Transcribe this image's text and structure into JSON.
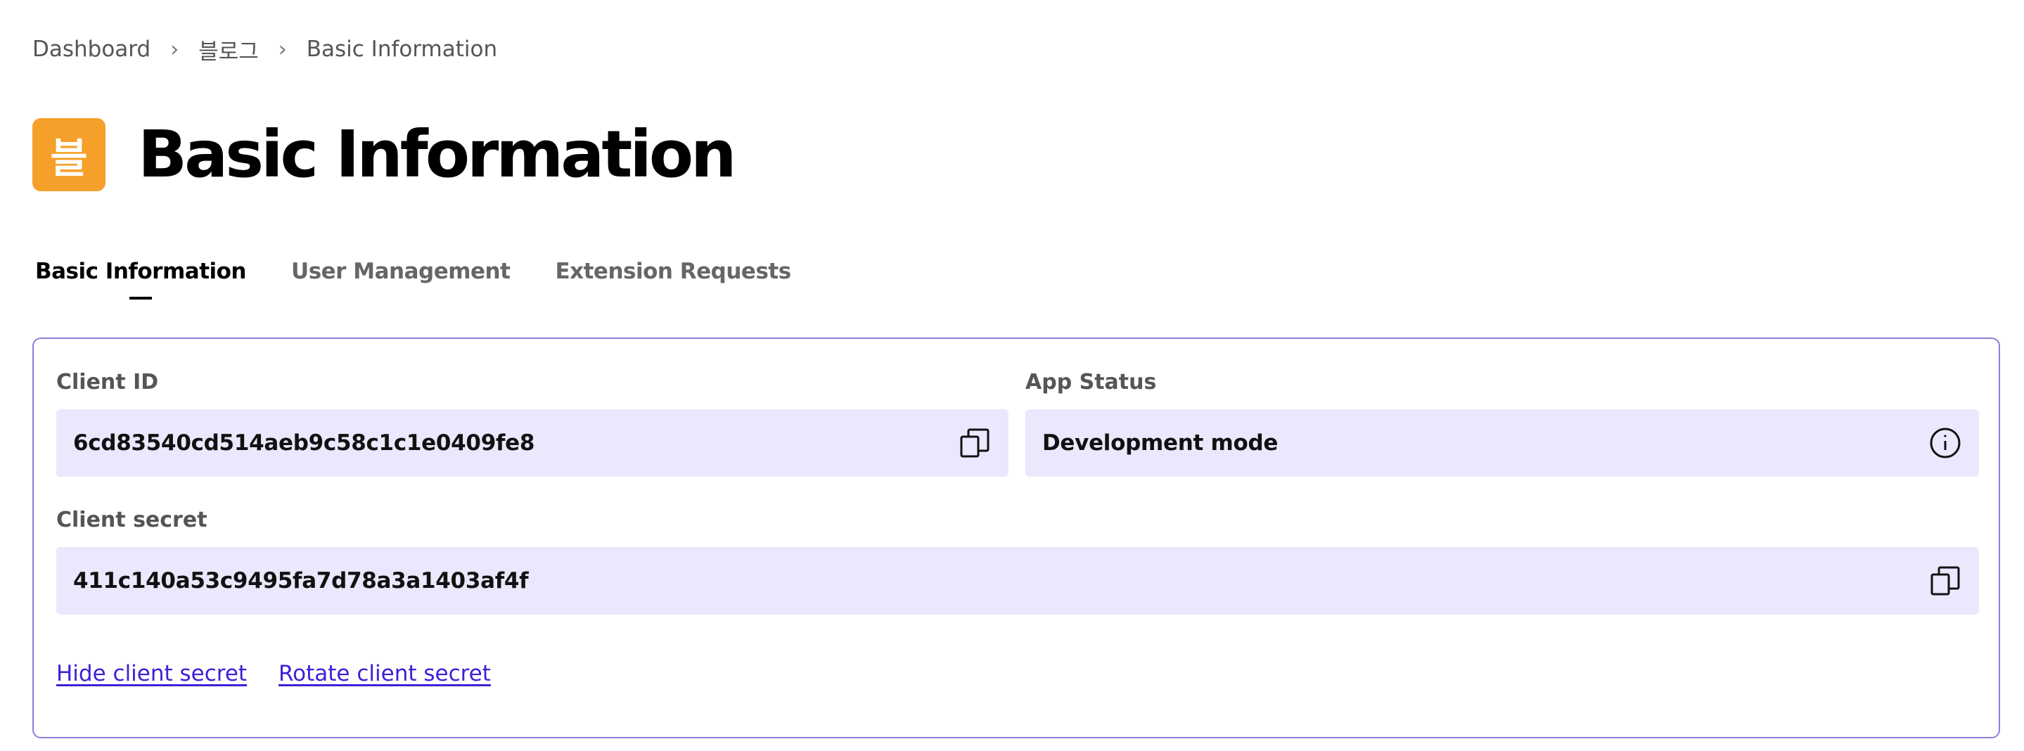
{
  "breadcrumb": {
    "items": [
      "Dashboard",
      "블로그",
      "Basic Information"
    ],
    "separator": "›"
  },
  "header": {
    "app_icon_glyph": "블",
    "app_icon_color": "#f5a02a",
    "title": "Basic Information"
  },
  "tabs": [
    {
      "label": "Basic Information",
      "active": true
    },
    {
      "label": "User Management",
      "active": false
    },
    {
      "label": "Extension Requests",
      "active": false
    }
  ],
  "card": {
    "client_id": {
      "label": "Client ID",
      "value": "6cd83540cd514aeb9c58c1c1e0409fe8",
      "icon": "copy-icon"
    },
    "app_status": {
      "label": "App Status",
      "value": "Development mode",
      "icon": "info-icon"
    },
    "client_secret": {
      "label": "Client secret",
      "value": "411c140a53c9495fa7d78a3a1403af4f",
      "icon": "copy-icon"
    },
    "links": {
      "hide_secret": "Hide client secret",
      "rotate_secret": "Rotate client secret"
    }
  },
  "colors": {
    "accent_border": "#8b7fe0",
    "field_background": "#ebe7fd",
    "link": "#3f1fd6"
  }
}
